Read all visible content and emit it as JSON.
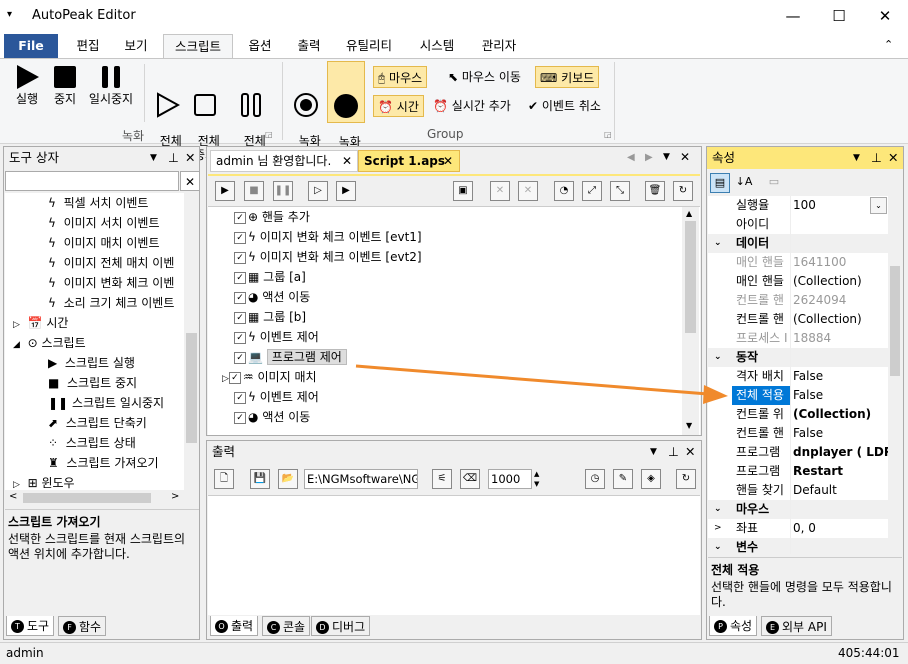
{
  "app": {
    "title": "AutoPeak Editor",
    "menu_icon": "▾",
    "minimize": "—",
    "maximize": "☐",
    "close": "✕"
  },
  "ribbon_tabs": [
    "File",
    "편집",
    "보기",
    "스크립트",
    "옵션",
    "출력",
    "유틸리티",
    "시스템",
    "관리자"
  ],
  "ribbon": {
    "record_group": {
      "label": "녹화",
      "buttons": [
        "실행",
        "중지",
        "일시중지",
        "전체\n실행",
        "전체\n중지",
        "전체\n일시중지"
      ]
    },
    "group": {
      "label": "Group",
      "rec_start": "녹화\n시작",
      "rec_stop": "녹화\n중지",
      "mouse": "마우스",
      "mouse_move": "마우스 이동",
      "keyboard": "키보드",
      "time": "시간",
      "realtime_add": "실시간 추가",
      "event_cancel": "이벤트 취소"
    }
  },
  "toolbox": {
    "title": "도구 상자",
    "items": [
      "픽셀 서치 이벤트",
      "이미지 서치 이벤트",
      "이미지 매치 이벤트",
      "이미지 전체 매치 이벤",
      "이미지 변화 체크 이벤",
      "소리 크기 체크 이벤트"
    ],
    "cat_time": "시간",
    "cat_script": "스크립트",
    "script_items": [
      "스크립트 실행",
      "스크립트 중지",
      "스크립트 일시중지",
      "스크립트 단축키",
      "스크립트 상태",
      "스크립트 가져오기"
    ],
    "cat_window": "윈도우",
    "desc_title": "스크립트 가져오기",
    "desc_text": "선택한 스크립트를 현재 스크립트의 액션 위치에 추가합니다.",
    "tabs": [
      {
        "label": "도구",
        "icon": "T"
      },
      {
        "label": "함수",
        "icon": "F"
      }
    ]
  },
  "editor": {
    "tabs": [
      "admin 님 환영합니다.",
      "Script 1.aps"
    ],
    "lines": [
      "핸들 추가",
      "이미지 변화 체크 이벤트 [evt1]",
      "이미지 변화 체크 이벤트 [evt2]",
      "그룹 [a]",
      "액션 이동",
      "그룹 [b]",
      "이벤트 제어",
      "프로그램 제어",
      "이미지 매치",
      "이벤트 제어",
      "액션 이동"
    ]
  },
  "output": {
    "title": "출력",
    "path": "E:\\NGMsoftware\\NG",
    "count": "1000",
    "tabs": [
      {
        "label": "출력",
        "icon": "O"
      },
      {
        "label": "콘솔",
        "icon": "C"
      },
      {
        "label": "디버그",
        "icon": "D"
      }
    ]
  },
  "properties": {
    "title": "속성",
    "rows": [
      {
        "k": "실행율",
        "v": "100",
        "type": "row"
      },
      {
        "k": "아이디",
        "v": "",
        "type": "row"
      },
      {
        "k": "데이터",
        "type": "cat"
      },
      {
        "k": "매인 핸들",
        "v": "1641100",
        "type": "gray"
      },
      {
        "k": "매인 핸들",
        "v": "(Collection)",
        "type": "row"
      },
      {
        "k": "컨트롤 핸",
        "v": "2624094",
        "type": "gray"
      },
      {
        "k": "컨트롤 핸",
        "v": "(Collection)",
        "type": "row"
      },
      {
        "k": "프로세스 I",
        "v": "18884",
        "type": "gray"
      },
      {
        "k": "동작",
        "type": "cat"
      },
      {
        "k": "격자 배치",
        "v": "False",
        "type": "row"
      },
      {
        "k": "전체 적용",
        "v": "False",
        "type": "sel"
      },
      {
        "k": "컨트롤 위",
        "v": "(Collection)",
        "type": "bold"
      },
      {
        "k": "컨트롤 핸",
        "v": "False",
        "type": "row"
      },
      {
        "k": "프로그램",
        "v": "dnplayer ( LDPla",
        "type": "bold"
      },
      {
        "k": "프로그램",
        "v": "Restart",
        "type": "bold"
      },
      {
        "k": "핸들 찾기",
        "v": "Default",
        "type": "row"
      },
      {
        "k": "마우스",
        "type": "cat"
      },
      {
        "k": "좌표",
        "v": "0, 0",
        "type": "exp"
      },
      {
        "k": "변수",
        "type": "cat"
      }
    ],
    "desc_title": "전체 적용",
    "desc_text": "선택한 핸들에 명령을 모두 적용합니다.",
    "tabs": [
      {
        "label": "속성",
        "icon": "P"
      },
      {
        "label": "외부 API",
        "icon": "E"
      }
    ]
  },
  "status": {
    "user": "admin",
    "time": "405:44:01"
  },
  "colors": {
    "accent": "#2b579a",
    "highlight": "#fde77a",
    "arrow": "#f08a2c",
    "selection": "#0078d7"
  }
}
